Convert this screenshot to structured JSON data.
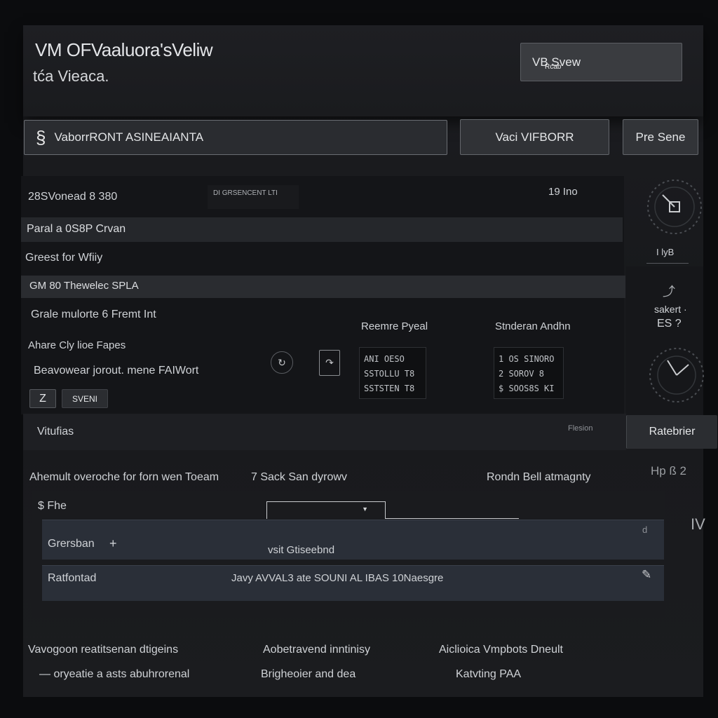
{
  "header": {
    "title": "VM OFVaaluora'sVeliw",
    "subtitle": "tća Vieaca.",
    "top_right_button": "VB Svew",
    "top_right_button_small": "Rcab"
  },
  "toolbar": {
    "search_value": "VaborrRONT ASINEAIANTA",
    "primary_button": "Vaci VIFBORR",
    "secondary_button": "Pre Sene"
  },
  "summary": {
    "item_count": "28SVonead  8  380",
    "center_badge": "DI GRSENCENT LTI",
    "right_count": "19  Ino",
    "band_1": "Paral a 0S8P Crvan",
    "line_1": "Greest for Wfiiy",
    "band_2": "GM   80  Thewelec SPLA",
    "line_2": "Grale mulorte 6 Fremt Int",
    "line_3": "Ahare Cly lioe   Fapes",
    "line_4": "Beavowear jorout. mene FAIWort",
    "save_icon_button": "Z",
    "save_button": "SVENI"
  },
  "reserve_panel": {
    "title": "Reemre Pyeal",
    "rows": [
      "ANI    OESO",
      "SSTOLLU   T8",
      "SSTSTEN   T8"
    ]
  },
  "student_panel": {
    "title": "Stnderan Andhn",
    "rows": [
      "1  OS SINORO",
      "2   SOROV 8",
      "$   SOOS8S KI"
    ]
  },
  "side_gauges": {
    "gauge_1_label": "I lyB",
    "gauge_2_label": "sakert ·",
    "gauge_2_value": "ES  ?"
  },
  "section_bar": {
    "left": "Vitufias",
    "right_tag": "Flesion",
    "right_button": "Ratebrier"
  },
  "lower": {
    "heading": "Ahemult overoche for forn wen Toeam",
    "step": "7  Sack San dyrowv",
    "right_heading": "Rondn Bell atmagnty",
    "right_icons": "Hp  ß  2",
    "label_s": "$ Fhe",
    "icon_right": "IV",
    "rows": [
      {
        "label": "Grersban",
        "icon": "+",
        "center": "vsit Gtiseebnd",
        "end_icon": "d"
      },
      {
        "label": "Ratfontad",
        "icon": "",
        "center": "Javy AVVAL3 ate SOUNI AL IBAS 10Naesgre",
        "end_icon": "✎"
      }
    ]
  },
  "footer": {
    "col_1": [
      "Vavogoon reatitsenan dtigeins",
      "— oryeatie a asts abuhrorenal"
    ],
    "col_2": [
      "Aobetravend inntinisy",
      "Brigheoier and dea"
    ],
    "col_3": [
      "Aiclioica Vmpbots Dneult",
      "Katvting PAA"
    ]
  },
  "colors": {
    "background": "#0b0c0e",
    "window": "#1c1d21",
    "band": "#25272b",
    "row": "#2a2f38",
    "text": "#cfd2d6"
  }
}
